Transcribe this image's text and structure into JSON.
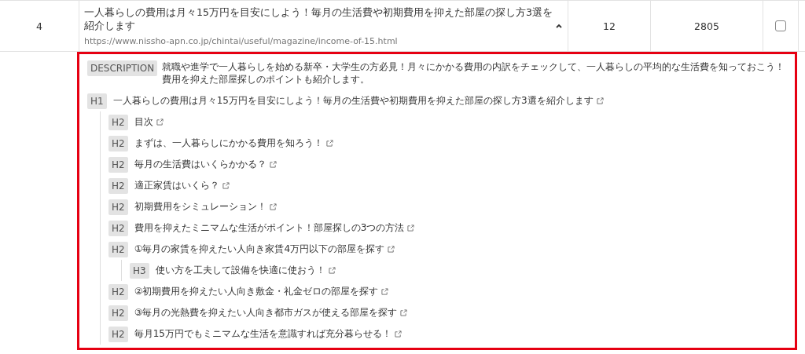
{
  "row": {
    "index": "4",
    "title": "一人暮らしの費用は月々15万円を目安にしよう！毎月の生活費や初期費用を抑えた部屋の探し方3選を紹介します",
    "url": "https://www.nissho-apn.co.jp/chintai/useful/magazine/income-of-15.html",
    "expanded": true,
    "column_3": "12",
    "column_4": "2805",
    "checked": false
  },
  "details": {
    "description": {
      "label": "DESCRIPTION",
      "text": "就職や進学で一人暮らしを始める新卒・大学生の方必見！月々にかかる費用の内訳をチェックして、一人暮らしの平均的な生活費を知っておこう！費用を抑えた部屋探しのポイントも紹介します。"
    },
    "headings": [
      {
        "tag": "H1",
        "text": "一人暮らしの費用は月々15万円を目安にしよう！毎月の生活費や初期費用を抑えた部屋の探し方3選を紹介します",
        "children": [
          {
            "tag": "H2",
            "text": "目次"
          },
          {
            "tag": "H2",
            "text": "まずは、一人暮らしにかかる費用を知ろう！"
          },
          {
            "tag": "H2",
            "text": "毎月の生活費はいくらかかる？"
          },
          {
            "tag": "H2",
            "text": "適正家賃はいくら？"
          },
          {
            "tag": "H2",
            "text": "初期費用をシミュレーション！"
          },
          {
            "tag": "H2",
            "text": "費用を抑えたミニマムな生活がポイント！部屋探しの3つの方法"
          },
          {
            "tag": "H2",
            "text": "①毎月の家賃を抑えたい人向き家賃4万円以下の部屋を探す",
            "children": [
              {
                "tag": "H3",
                "text": "使い方を工夫して設備を快適に使おう！"
              }
            ]
          },
          {
            "tag": "H2",
            "text": "②初期費用を抑えたい人向き敷金・礼金ゼロの部屋を探す"
          },
          {
            "tag": "H2",
            "text": "③毎月の光熱費を抑えたい人向き都市ガスが使える部屋を探す"
          },
          {
            "tag": "H2",
            "text": "毎月15万円でもミニマムな生活を意識すれば充分暮らせる！"
          }
        ]
      }
    ]
  }
}
